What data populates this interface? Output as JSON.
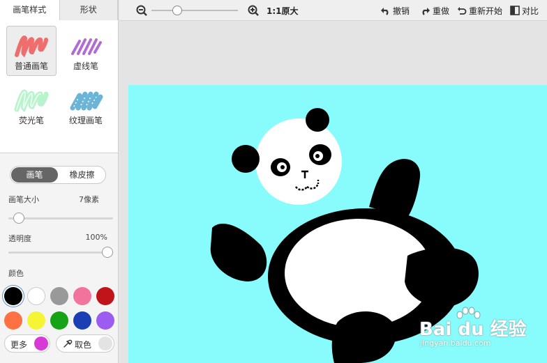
{
  "tabs": {
    "brush_style": "画笔样式",
    "shape": "形状"
  },
  "brushes": [
    {
      "label": "普通画笔",
      "icon": "plain-brush-icon",
      "color": "#f06d6d",
      "selected": true
    },
    {
      "label": "虚线笔",
      "icon": "dashed-brush-icon",
      "color": "#b46bd0",
      "selected": false
    },
    {
      "label": "荧光笔",
      "icon": "highlighter-icon",
      "color": "#a8f0c0",
      "selected": false
    },
    {
      "label": "纹理画笔",
      "icon": "texture-brush-icon",
      "color": "#6ab4d8",
      "selected": false
    }
  ],
  "mode": {
    "brush": "画笔",
    "eraser": "橡皮擦"
  },
  "brush_size": {
    "label": "画笔大小",
    "value": "7像素",
    "level": 0.05
  },
  "opacity": {
    "label": "透明度",
    "value": "100%",
    "level": 1.0
  },
  "color_label": "颜色",
  "colors": [
    "#000000",
    "#ffffff",
    "#999999",
    "#f2739b",
    "#c0141a",
    "#ff7043",
    "#f5f535",
    "#16a316",
    "#1a3fb4",
    "#9c5cf0"
  ],
  "selected_color": "#000000",
  "more": {
    "label": "更多",
    "color": "#d83ad8"
  },
  "picker": {
    "label": "取色",
    "color": "#e3e3e3"
  },
  "toolbar": {
    "zoom_label": "1:1原大",
    "undo": "撤销",
    "redo": "重做",
    "restart": "重新开始",
    "compare": "对比"
  },
  "canvas": {
    "background": "#88fbfc"
  },
  "watermark": {
    "main": "Bai du 经验",
    "sub": "jingyan.baidu.com"
  }
}
